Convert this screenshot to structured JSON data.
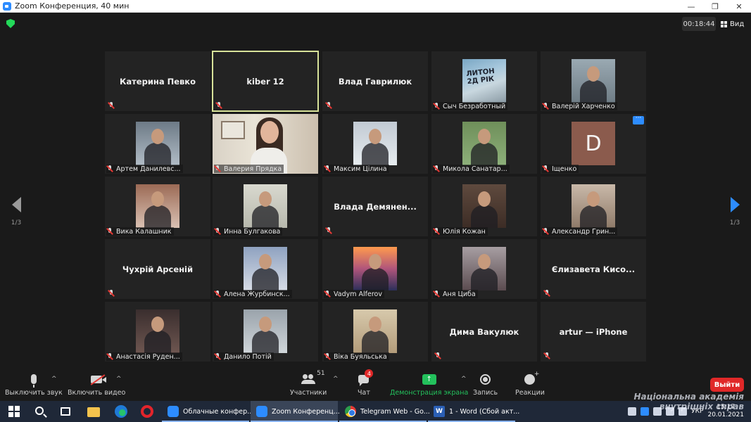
{
  "window": {
    "title": "Zoom Конференция, 40 мин",
    "controls": [
      "—",
      "❐",
      "✕"
    ]
  },
  "meeting": {
    "timer": "00:18:44",
    "view_label": "Вид",
    "page_left": "1/3",
    "page_right": "1/3"
  },
  "tiles": [
    {
      "name": "Катерина Певко",
      "label": "",
      "type": "name"
    },
    {
      "name": "kiber 12",
      "label": "",
      "type": "name",
      "active": true
    },
    {
      "name": "Влад Гаврилюк",
      "label": "",
      "type": "name"
    },
    {
      "name": "",
      "label": "Сыч Безработный",
      "type": "photo",
      "photo": "sign"
    },
    {
      "name": "",
      "label": "Валерій Харченко",
      "type": "photo",
      "photo": "bg1"
    },
    {
      "name": "",
      "label": "Артем Данилевс...",
      "type": "photo",
      "photo": "bg14"
    },
    {
      "name": "",
      "label": "Валерия Прядка",
      "type": "video"
    },
    {
      "name": "",
      "label": "Максим Цілина",
      "type": "photo",
      "photo": "bg3"
    },
    {
      "name": "",
      "label": "Микола Санатар...",
      "type": "photo",
      "photo": "bg4"
    },
    {
      "name": "",
      "label": "Іщенко",
      "type": "avatar",
      "letter": "D"
    },
    {
      "name": "",
      "label": "Вика Калашник",
      "type": "photo",
      "photo": "bg11"
    },
    {
      "name": "",
      "label": "Инна Булгакова",
      "type": "photo",
      "photo": "bg5"
    },
    {
      "name": "Влада  Демянен...",
      "label": "",
      "type": "name"
    },
    {
      "name": "",
      "label": "Юлія Кожан",
      "type": "photo",
      "photo": "bg6"
    },
    {
      "name": "",
      "label": "Александр Грин...",
      "type": "photo",
      "photo": "bg7"
    },
    {
      "name": "Чухрій Арсеній",
      "label": "",
      "type": "name"
    },
    {
      "name": "",
      "label": "Алена Журбинск...",
      "type": "photo",
      "photo": "bg9"
    },
    {
      "name": "",
      "label": "Vadym Alferov",
      "type": "photo",
      "photo": "bg10"
    },
    {
      "name": "",
      "label": "Аня Циба",
      "type": "photo",
      "photo": "bg8"
    },
    {
      "name": "Єлизавета  Кисо...",
      "label": "",
      "type": "name"
    },
    {
      "name": "",
      "label": "Анастасія Руден...",
      "type": "photo",
      "photo": "bg12"
    },
    {
      "name": "",
      "label": "Данило Потій",
      "type": "photo",
      "photo": "bg13"
    },
    {
      "name": "",
      "label": "Віка Буяльська",
      "type": "photo",
      "photo": "bg2"
    },
    {
      "name": "Дима Вакулюк",
      "label": "",
      "type": "name"
    },
    {
      "name": "artur — iPhone",
      "label": "",
      "type": "name"
    }
  ],
  "toolbar": {
    "mute_label": "Выключить звук",
    "video_label": "Включить видео",
    "participants_label": "Участники",
    "participants_count": "51",
    "chat_label": "Чат",
    "chat_badge": "4",
    "share_label": "Демонстрация экрана",
    "record_label": "Запись",
    "reactions_label": "Реакции",
    "leave_label": "Выйти"
  },
  "taskbar": {
    "tasks": [
      {
        "label": "Облачные конфер..."
      },
      {
        "label": "Zoom Конференц..."
      },
      {
        "label": "Telegram Web - Go..."
      },
      {
        "label": "1 - Word (Сбой акт..."
      }
    ],
    "lang": "УКР",
    "time": "15:17",
    "date": "20.01.2021"
  },
  "watermark": {
    "line1": "Національна академія",
    "line2": "внутрішніх справ"
  },
  "colors": {
    "accent": "#2d8cff",
    "share_green": "#23c15c",
    "leave_red": "#e02828",
    "active_tile_outline": "#d8e39a"
  }
}
